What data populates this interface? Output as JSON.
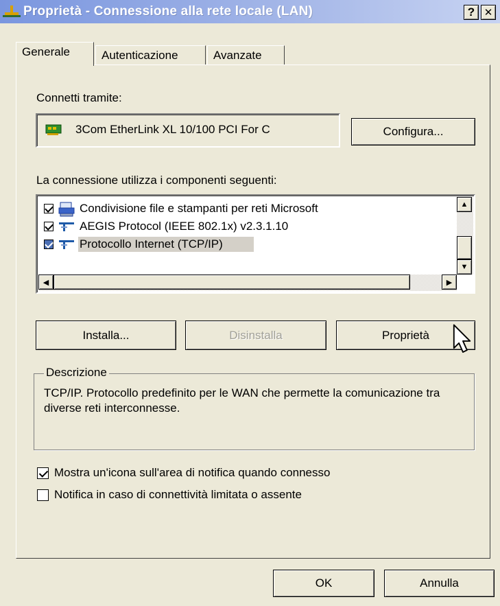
{
  "window": {
    "title": "Proprietà - Connessione alla rete locale (LAN)",
    "help_label": "?",
    "close_label": "✕"
  },
  "tabs": [
    {
      "label": "Generale",
      "active": true
    },
    {
      "label": "Autenticazione",
      "active": false
    },
    {
      "label": "Avanzate",
      "active": false
    }
  ],
  "general": {
    "connect_label": "Connetti tramite:",
    "adapter_name": "3Com EtherLink XL 10/100 PCI For C",
    "configure_label": "Configura...",
    "components_label": "La connessione utilizza i componenti seguenti:",
    "components": [
      {
        "label": "Condivisione file e stampanti per reti Microsoft",
        "checked": true,
        "icon": "printer-share-icon"
      },
      {
        "label": "AEGIS Protocol (IEEE 802.1x) v2.3.1.10",
        "checked": true,
        "icon": "network-protocol-icon"
      },
      {
        "label": "Protocollo Internet (TCP/IP)",
        "checked": true,
        "icon": "network-protocol-icon"
      }
    ],
    "install_label": "Installa...",
    "uninstall_label": "Disinstalla",
    "properties_label": "Proprietà",
    "description_title": "Descrizione",
    "description_text": "TCP/IP. Protocollo predefinito per le WAN che permette la comunicazione tra diverse reti interconnesse.",
    "show_icon_label": "Mostra un'icona sull'area di notifica quando connesso",
    "show_icon_checked": true,
    "notify_label": "Notifica in caso di connettività limitata o assente",
    "notify_checked": false
  },
  "footer": {
    "ok_label": "OK",
    "cancel_label": "Annulla"
  }
}
